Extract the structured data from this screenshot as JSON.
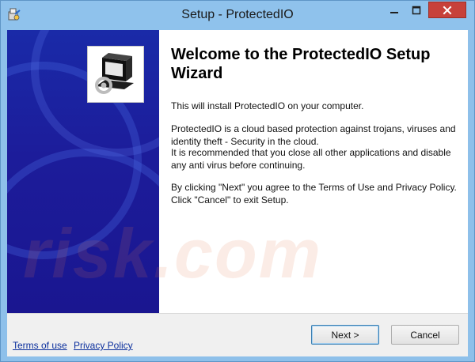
{
  "window": {
    "title": "Setup - ProtectedIO"
  },
  "icons": {
    "app": "installer-icon",
    "minimize": "minimize-icon",
    "maximize": "maximize-icon",
    "close": "close-icon",
    "wizard": "computer-install-icon"
  },
  "content": {
    "heading": "Welcome to the ProtectedIO Setup Wizard",
    "paragraph1": "This will install ProtectedIO on your computer.",
    "paragraph2": "ProtectedIO is a cloud based protection against trojans, viruses and identity theft - Security in the cloud.",
    "paragraph3": "It is recommended that you close all other applications and disable any anti virus before continuing.",
    "paragraph4": "By clicking \"Next\" you agree to the Terms of Use and Privacy Policy. Click \"Cancel\" to exit Setup."
  },
  "footer": {
    "terms_link": "Terms of use",
    "privacy_link": "Privacy Policy",
    "next_button": "Next >",
    "cancel_button": "Cancel"
  },
  "watermark": "risk.com",
  "colors": {
    "titlebar": "#8fc2ec",
    "close_button": "#c7413a",
    "side_panel": "#1a1a9c",
    "link": "#0b2f9d"
  }
}
